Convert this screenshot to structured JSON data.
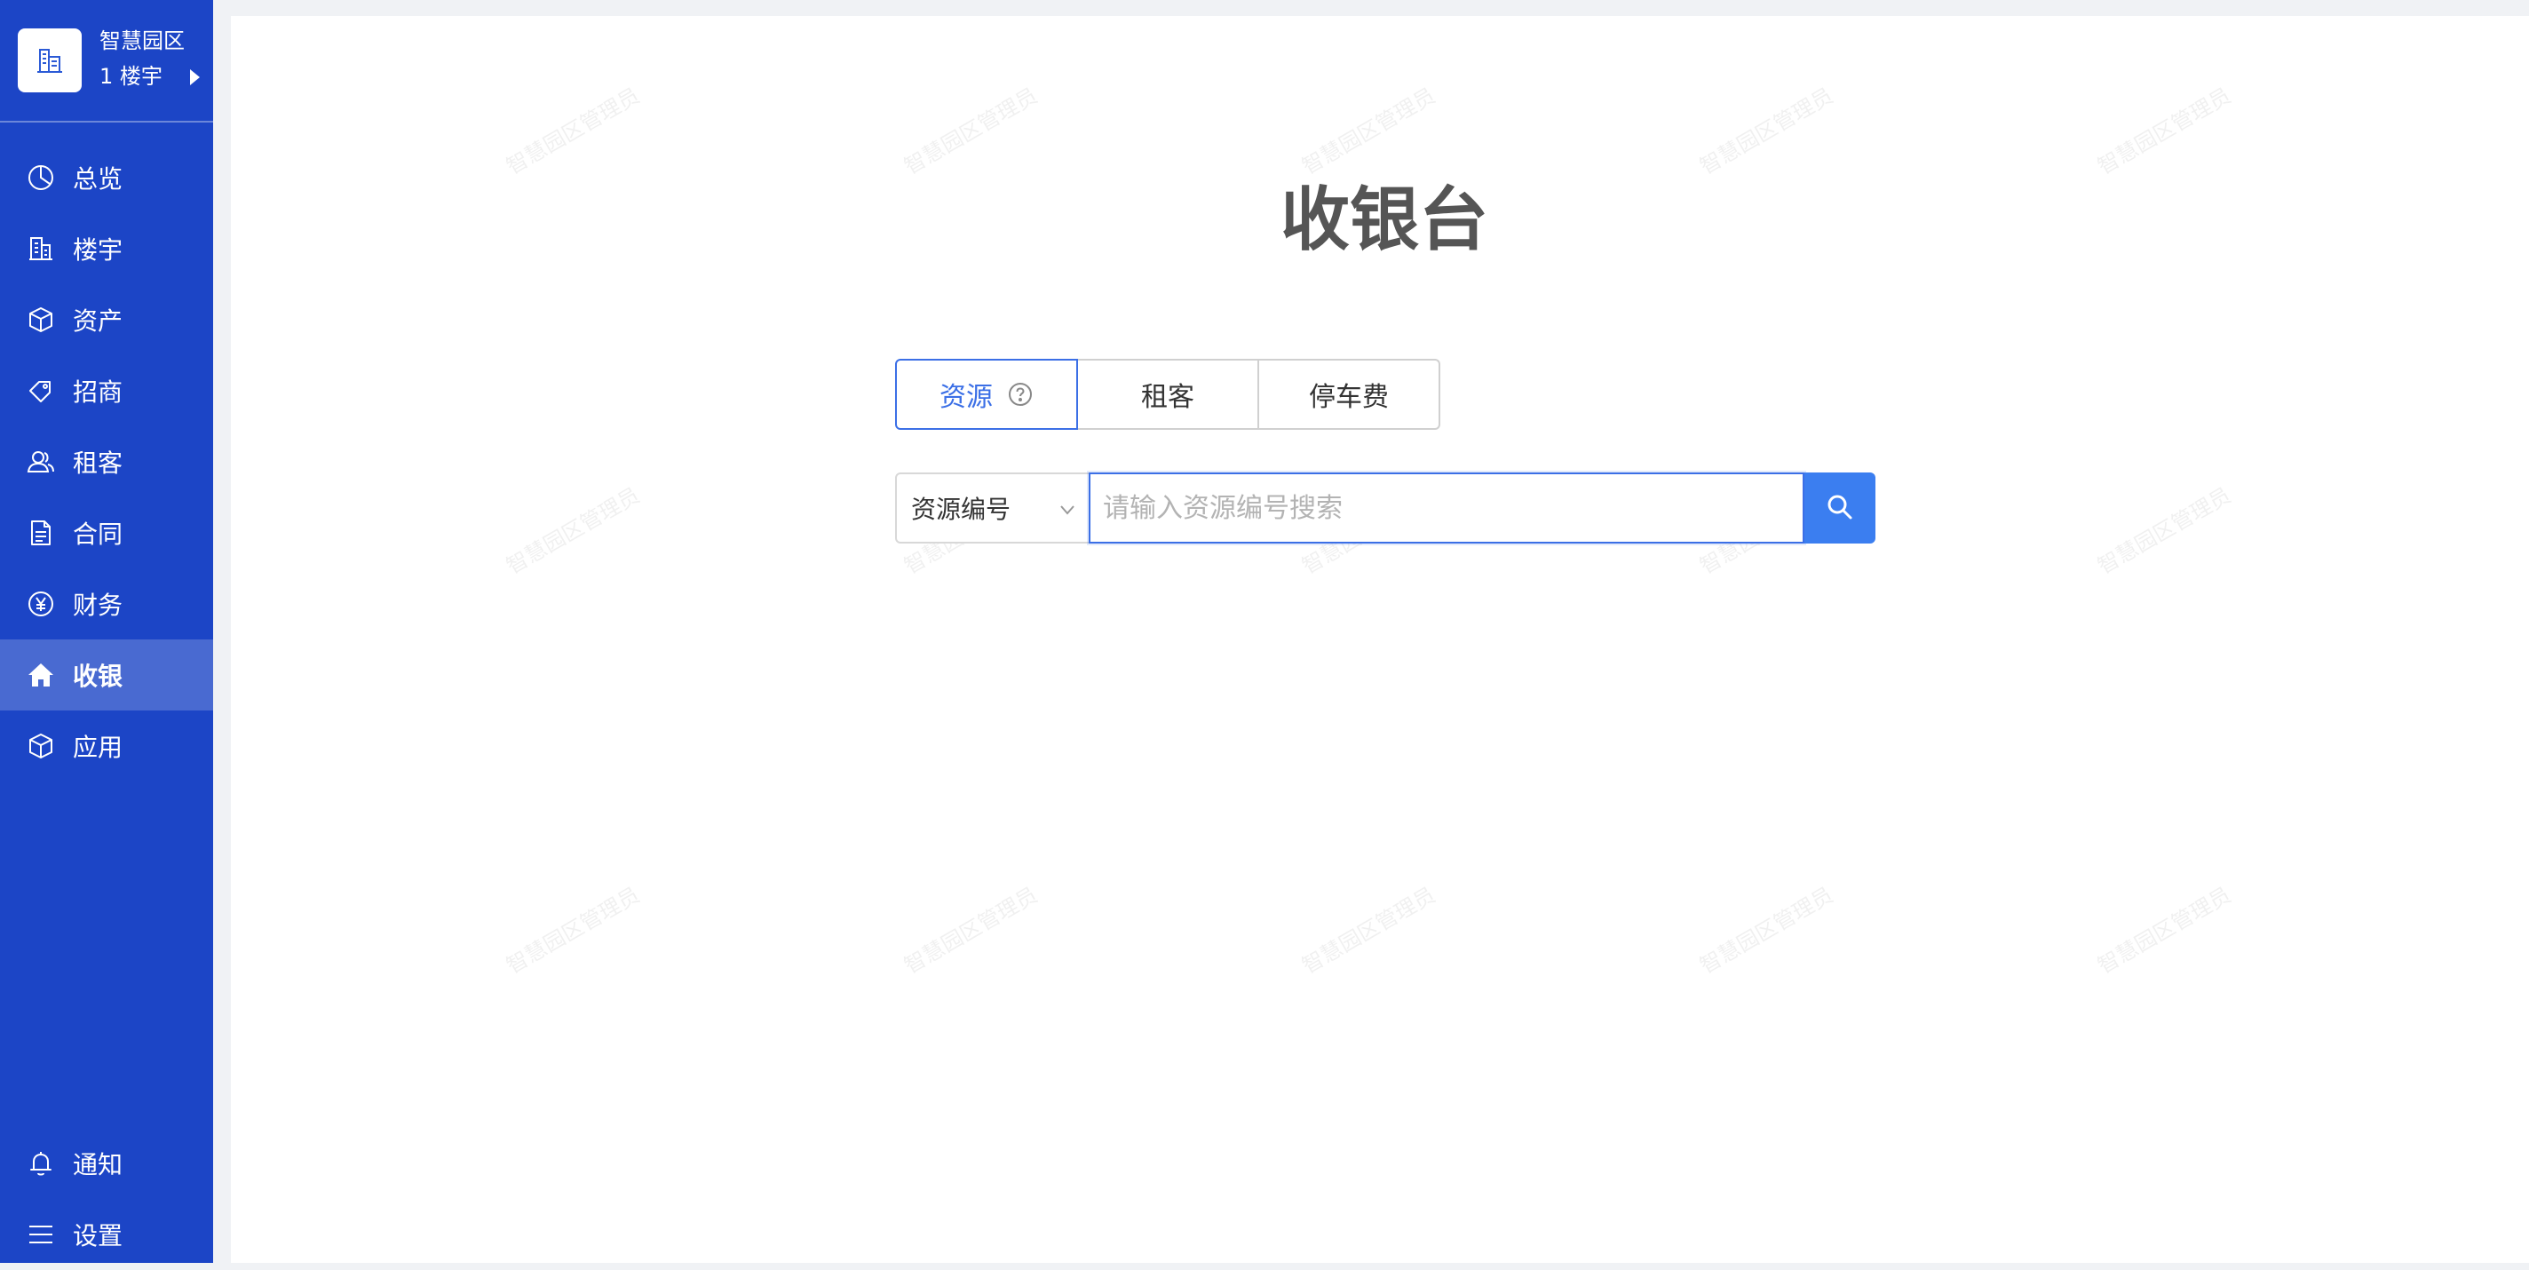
{
  "brand": {
    "name": "智慧园区",
    "sub": "1 楼宇",
    "logo_icon": "building-icon",
    "arrow_icon": "caret-right-icon"
  },
  "sidebar": {
    "items": [
      {
        "label": "总览",
        "icon": "pie-chart-icon",
        "active": false
      },
      {
        "label": "楼宇",
        "icon": "building-icon",
        "active": false
      },
      {
        "label": "资产",
        "icon": "cube-icon",
        "active": false
      },
      {
        "label": "招商",
        "icon": "tag-icon",
        "active": false
      },
      {
        "label": "租客",
        "icon": "users-icon",
        "active": false
      },
      {
        "label": "合同",
        "icon": "document-icon",
        "active": false
      },
      {
        "label": "财务",
        "icon": "yen-icon",
        "active": false
      },
      {
        "label": "收银",
        "icon": "home-icon",
        "active": true
      },
      {
        "label": "应用",
        "icon": "box-icon",
        "active": false
      }
    ],
    "bottom_items": [
      {
        "label": "通知",
        "icon": "bell-icon"
      },
      {
        "label": "设置",
        "icon": "menu-icon"
      }
    ]
  },
  "watermark": "智慧园区管理员",
  "main": {
    "title": "收银台",
    "tabs": [
      {
        "label": "资源",
        "active": true,
        "help_icon": "question-circle-icon"
      },
      {
        "label": "租客",
        "active": false
      },
      {
        "label": "停车费",
        "active": false
      }
    ],
    "search": {
      "select_value": "资源编号",
      "placeholder": "请输入资源编号搜索",
      "value": "",
      "button_icon": "search-icon"
    }
  },
  "colors": {
    "sidebar_bg": "#1c45c6",
    "accent": "#3b6fe6",
    "search_button": "#3b7ef0"
  }
}
